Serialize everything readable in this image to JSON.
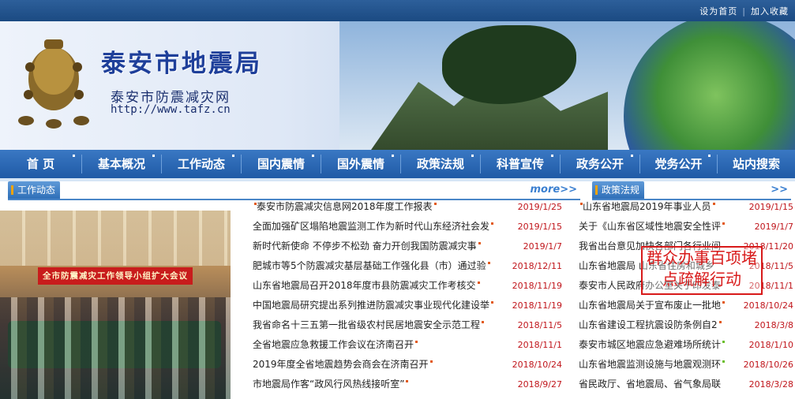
{
  "toplinks": {
    "home": "设为首页",
    "fav": "加入收藏"
  },
  "header": {
    "title": "泰安市地震局",
    "subtitle": "泰安市防震减灾网",
    "url": "http://www.tafz.cn"
  },
  "nav": [
    "首 页",
    "基本概况",
    "工作动态",
    "国内震情",
    "国外震情",
    "政策法规",
    "科普宣传",
    "政务公开",
    "党务公开",
    "站内搜索"
  ],
  "work": {
    "title": "工作动态",
    "more": "more>>",
    "photo_banner": "全市防震减灾工作领导小组扩大会议",
    "items": [
      {
        "title": "泰安市防震减灾信息网2018年度工作报表",
        "date": "2019/1/25"
      },
      {
        "title": "全面加强矿区塌陷地震监测工作为新时代山东经济社会发",
        "date": "2019/1/15"
      },
      {
        "title": "新时代新使命 不停步不松劲 奋力开创我国防震减灾事",
        "date": "2019/1/7"
      },
      {
        "title": "肥城市等5个防震减灾基层基础工作强化县（市）通过验",
        "date": "2018/12/11"
      },
      {
        "title": "山东省地震局召开2018年度市县防震减灾工作考核交",
        "date": "2018/11/19"
      },
      {
        "title": "中国地震局研究提出系列推进防震减灾事业现代化建设举",
        "date": "2018/11/19"
      },
      {
        "title": "我省命名十三五第一批省级农村民居地震安全示范工程",
        "date": "2018/11/5"
      },
      {
        "title": "全省地震应急救援工作会议在济南召开",
        "date": "2018/11/1"
      },
      {
        "title": "2019年度全省地震趋势会商会在济南召开",
        "date": "2018/10/24"
      },
      {
        "title": "市地震局作客“政风行风热线接听室”",
        "date": "2018/9/27"
      }
    ]
  },
  "policy": {
    "title": "政策法规",
    "more": ">>",
    "stamp": "群众办事百项堵点疏解行动",
    "items": [
      {
        "title": "山东省地震局2019年事业人员",
        "date": "2019/1/15"
      },
      {
        "title": "关于《山东省区域性地震安全性评",
        "date": "2019/1/7"
      },
      {
        "title": "我省出台意见加快各部门各行业间",
        "date": "2018/11/20"
      },
      {
        "title": "山东省地震局 山东省住房和城乡",
        "date": "2018/11/5"
      },
      {
        "title": "泰安市人民政府办公室关于印发泰",
        "date": "2018/11/1"
      },
      {
        "title": "山东省地震局关于宣布废止一批地",
        "date": "2018/10/24"
      },
      {
        "title": "山东省建设工程抗震设防条例自2",
        "date": "2018/3/8"
      },
      {
        "title": "泰安市城区地震应急避难场所统计",
        "date": "2018/1/10"
      },
      {
        "title": "山东省地震监测设施与地震观测环",
        "date": "2018/10/26"
      },
      {
        "title": "省民政厅、省地震局、省气象局联",
        "date": "2018/3/28"
      }
    ]
  }
}
